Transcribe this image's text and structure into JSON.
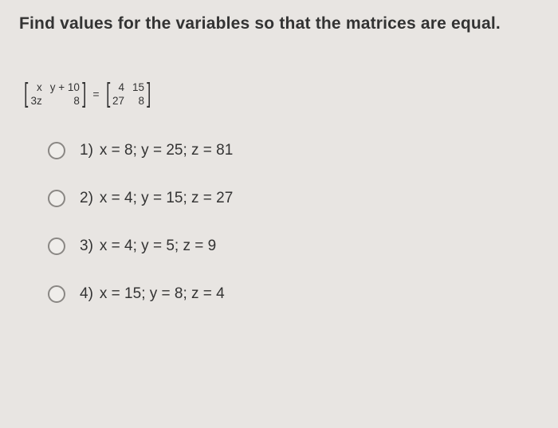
{
  "question": "Find values for the variables so that the matrices are equal.",
  "matrix_left": {
    "r1c1": "x",
    "r1c2": "y + 10",
    "r2c1": "3z",
    "r2c2": "8"
  },
  "equals": "=",
  "matrix_right": {
    "r1c1": "4",
    "r1c2": "15",
    "r2c1": "27",
    "r2c2": "8"
  },
  "options": [
    {
      "num": "1)",
      "text": "x = 8; y = 25; z = 81"
    },
    {
      "num": "2)",
      "text": "x = 4; y = 15; z = 27"
    },
    {
      "num": "3)",
      "text": "x = 4; y = 5; z = 9"
    },
    {
      "num": "4)",
      "text": "x = 15; y = 8; z = 4"
    }
  ]
}
